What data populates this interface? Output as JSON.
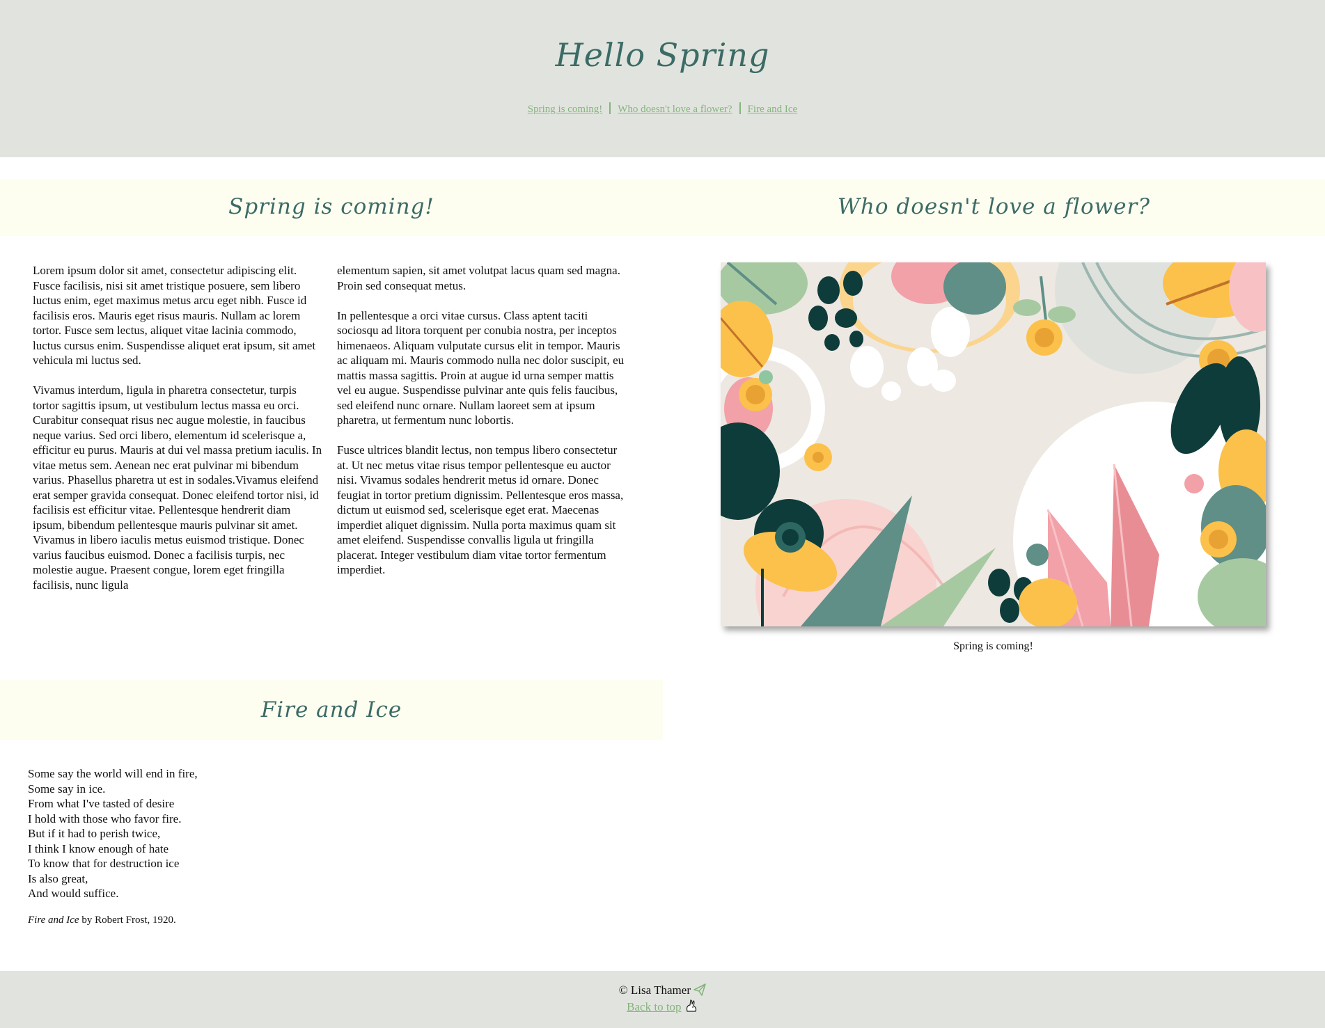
{
  "header": {
    "title": "Hello Spring",
    "nav": [
      {
        "label": "Spring is coming!"
      },
      {
        "label": "Who doesn't love a flower?"
      },
      {
        "label": "Fire and Ice"
      }
    ]
  },
  "sections": {
    "spring": {
      "title": "Spring is coming!",
      "paragraphs": [
        "Lorem ipsum dolor sit amet, consectetur adipiscing elit. Fusce facilisis, nisi sit amet tristique posuere, sem libero luctus enim, eget maximus metus arcu eget nibh. Fusce id facilisis eros. Mauris eget risus mauris. Nullam ac lorem tortor. Fusce sem lectus, aliquet vitae lacinia commodo, luctus cursus enim. Suspendisse aliquet erat ipsum, sit amet vehicula mi luctus sed.",
        "Vivamus interdum, ligula in pharetra consectetur, turpis tortor sagittis ipsum, ut vestibulum lectus massa eu orci. Curabitur consequat risus nec augue molestie, in faucibus neque varius. Sed orci libero, elementum id scelerisque a, efficitur eu purus. Mauris at dui vel massa pretium iaculis. In vitae metus sem. Aenean nec erat pulvinar mi bibendum varius. Phasellus pharetra ut est in sodales.Vivamus eleifend erat semper gravida consequat. Donec eleifend tortor nisi, id facilisis est efficitur vitae. Pellentesque hendrerit diam ipsum, bibendum pellentesque mauris pulvinar sit amet. Vivamus in libero iaculis metus euismod tristique. Donec varius faucibus euismod. Donec a facilisis turpis, nec molestie augue. Praesent congue, lorem eget fringilla facilisis, nunc ligula",
        "elementum sapien, sit amet volutpat lacus quam sed magna. Proin sed consequat metus.",
        "In pellentesque a orci vitae cursus. Class aptent taciti sociosqu ad litora torquent per conubia nostra, per inceptos himenaeos. Aliquam vulputate cursus elit in tempor. Mauris ac aliquam mi. Mauris commodo nulla nec dolor suscipit, eu mattis massa sagittis. Proin at augue id urna semper mattis vel eu augue. Suspendisse pulvinar ante quis felis faucibus, sed eleifend nunc ornare. Nullam laoreet sem at ipsum pharetra, ut fermentum nunc lobortis.",
        "Fusce ultrices blandit lectus, non tempus libero consectetur at. Ut nec metus vitae risus tempor pellentesque eu auctor nisi. Vivamus sodales hendrerit metus id ornare. Donec feugiat in tortor pretium dignissim. Pellentesque eros massa, dictum ut euismod sed, scelerisque eget erat. Maecenas imperdiet aliquet dignissim. Nulla porta maximus quam sit amet eleifend. Suspendisse convallis ligula ut fringilla placerat. Integer vestibulum diam vitae tortor fermentum imperdiet."
      ]
    },
    "flower": {
      "title": "Who doesn't love a flower?",
      "caption": "Spring is coming!"
    },
    "fire": {
      "title": "Fire and Ice",
      "poem": [
        "Some say the world will end in fire,",
        "Some say in ice.",
        "From what I've tasted of desire",
        "I hold with those who favor fire.",
        "But if it had to perish twice,",
        "I think I know enough of hate",
        "To know that for destruction ice",
        "Is also great,",
        "And would suffice."
      ],
      "credit_title": "Fire and Ice",
      "credit_rest": " by Robert Frost, 1920."
    }
  },
  "footer": {
    "copyright": "© Lisa Thamer",
    "back_to_top": "Back to top",
    "icons": [
      "paper-plane-icon",
      "rabbit-icon"
    ]
  },
  "colors": {
    "header_bg": "#e1e4de",
    "band_bg": "#fdfef0",
    "heading": "#3c6b66",
    "link": "#86b37e"
  }
}
